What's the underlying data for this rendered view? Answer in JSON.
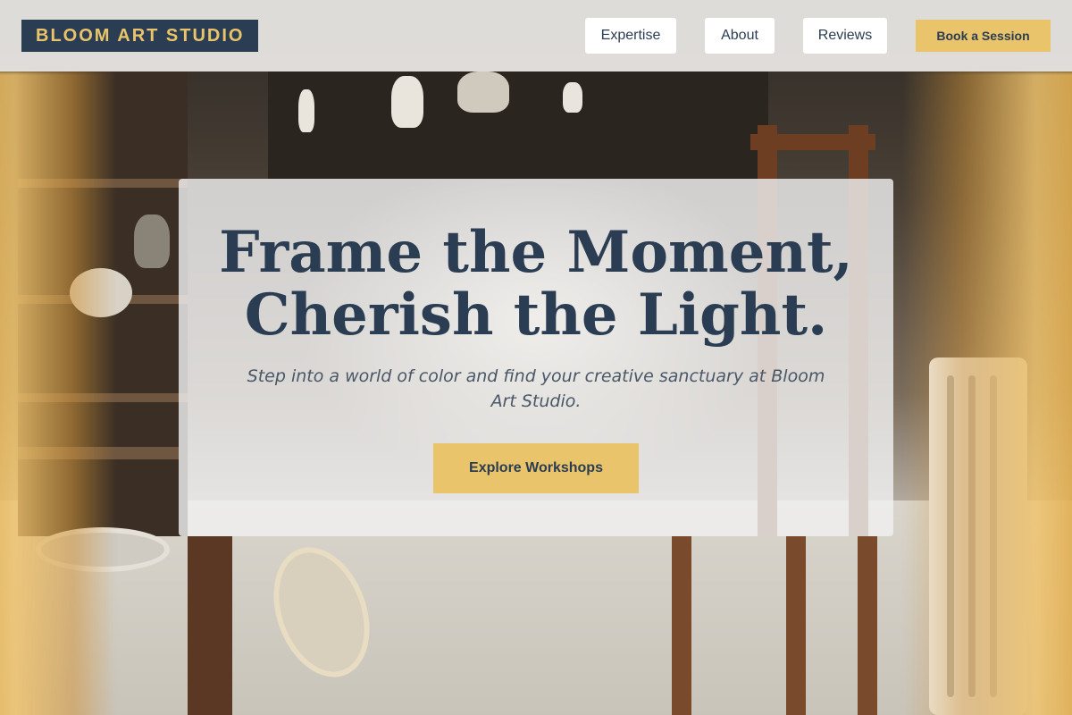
{
  "header": {
    "logo": "BLOOM ART STUDIO",
    "nav": [
      {
        "label": "Expertise"
      },
      {
        "label": "About"
      },
      {
        "label": "Reviews"
      }
    ],
    "cta_label": "Book a Session"
  },
  "hero": {
    "title_line1": "Frame the Moment,",
    "title_line2": "Cherish the Light.",
    "subtitle": "Step into a world of color and find your creative sanctuary at Bloom Art Studio.",
    "button_label": "Explore Workshops"
  },
  "colors": {
    "navy": "#2b3d52",
    "gold": "#e9c46a",
    "header_bg": "#eceae6"
  },
  "background_image": "art-studio-interior-photo"
}
